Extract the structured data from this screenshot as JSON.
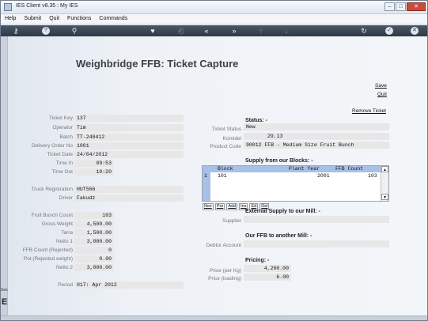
{
  "window": {
    "title": "IES Client v8.35 : My IES",
    "controls": {
      "minimize": "–",
      "maximize": "□",
      "close": "✕"
    }
  },
  "menu": {
    "items": [
      "Help",
      "Submit",
      "Quit",
      "Functions",
      "Commands"
    ]
  },
  "toolbar": {
    "icons": [
      {
        "name": "key-icon",
        "glyph": "⚷",
        "dim": false,
        "round": false
      },
      {
        "name": "help-icon",
        "glyph": "?",
        "dim": false,
        "round": true
      },
      {
        "name": "search-icon",
        "glyph": "⚲",
        "dim": false,
        "round": false
      },
      {
        "name": "heart-icon",
        "glyph": "♥",
        "dim": false,
        "round": false
      },
      {
        "name": "history-icon",
        "glyph": "◴",
        "dim": true,
        "round": false
      },
      {
        "name": "rewind-icon",
        "glyph": "«",
        "dim": false,
        "round": false
      },
      {
        "name": "forward-icon",
        "glyph": "»",
        "dim": false,
        "round": false
      },
      {
        "name": "upload-icon",
        "glyph": "↑",
        "dim": true,
        "round": false
      },
      {
        "name": "download-icon",
        "glyph": "↓",
        "dim": true,
        "round": false
      },
      {
        "name": "refresh-icon",
        "glyph": "↻",
        "dim": false,
        "round": false
      },
      {
        "name": "confirm-icon",
        "glyph": "✓",
        "dim": false,
        "round": true
      },
      {
        "name": "cancel-icon",
        "glyph": "✕",
        "dim": false,
        "round": true
      }
    ]
  },
  "sidebar": {
    "label": "Ses",
    "glyph": "E"
  },
  "page": {
    "title": "Weighbridge FFB: Ticket Capture",
    "links": {
      "save": "Save",
      "quit": "Quit",
      "remove_ticket": "Remove Ticket"
    }
  },
  "ticket": {
    "ticket_key": {
      "label": "Ticket Key",
      "value": "137"
    },
    "operator": {
      "label": "Operator",
      "value": "Tim"
    },
    "batch": {
      "label": "Batch",
      "value": "TT-240412"
    },
    "delivery_order_no": {
      "label": "Delivery Order No",
      "value": "1001"
    },
    "ticket_date": {
      "label": "Ticket Date",
      "value": "24/04/2012"
    },
    "time_in": {
      "label": "Time In",
      "value": "09:53"
    },
    "time_out": {
      "label": "Time Out",
      "value": "10:20"
    },
    "truck_registration": {
      "label": "Truck Registration",
      "value": "HUT566"
    },
    "driver": {
      "label": "Driver",
      "value": "Fakudz"
    },
    "fruit_bunch_count": {
      "label": "Fruit Bunch Count",
      "value": "103"
    },
    "gross_weight": {
      "label": "Gross Weight",
      "value": "4,500.00"
    },
    "tarra": {
      "label": "Tarra",
      "value": "1,500.00"
    },
    "netto_1": {
      "label": "Netto 1",
      "value": "3,000.00"
    },
    "ffb_count_rejected": {
      "label": "FFB Count (Rejected)",
      "value": "0"
    },
    "pot_rejected_weight": {
      "label": "Pot (Rejected weight)",
      "value": "0.00"
    },
    "netto_2": {
      "label": "Netto 2",
      "value": "3,000.00"
    },
    "period": {
      "label": "Period",
      "value": "017: Apr 2012"
    }
  },
  "status": {
    "heading": "Status: -",
    "ticket_status": {
      "label": "Ticket Status",
      "value": "New"
    },
    "komidel": {
      "label": "Komidel",
      "value": "29.13"
    },
    "product_code": {
      "label": "Product Code",
      "value": "90012 FFB - Medium Size Fruit Bunch"
    }
  },
  "blocks": {
    "heading": "Supply from our Blocks: -",
    "columns": [
      "Block",
      "Plant Year",
      "FFB Count"
    ],
    "rows": [
      {
        "num": "1",
        "block": "101",
        "plant_year": "2001",
        "ffb_count": "103"
      }
    ],
    "buttons": [
      "Nex",
      "Pre",
      "Add",
      "Ins",
      "Ed",
      "Del"
    ],
    "scroll_up": "▲",
    "scroll_down": "▼"
  },
  "external": {
    "heading": "External Supply to our Mill: -",
    "supplier": {
      "label": "Supplier",
      "value": ""
    }
  },
  "another_mill": {
    "heading": "Our FFB to another Mill: -",
    "debtor_account": {
      "label": "Debtor Account",
      "value": ""
    }
  },
  "pricing": {
    "heading": "Pricing: -",
    "price_per_kg": {
      "label": "Price (per Kg)",
      "value": "4,200.00"
    },
    "price_loading": {
      "label": "Price (loading)",
      "value": "6.00"
    }
  }
}
